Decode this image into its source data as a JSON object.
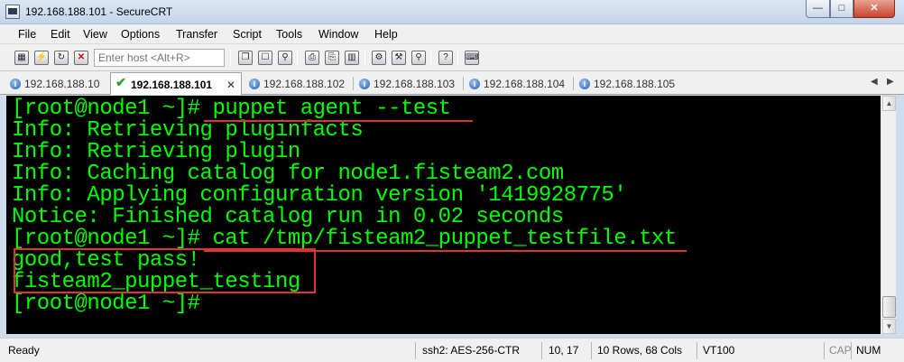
{
  "window": {
    "title": "192.168.188.101 - SecureCRT"
  },
  "menu": [
    "File",
    "Edit",
    "View",
    "Options",
    "Transfer",
    "Script",
    "Tools",
    "Window",
    "Help"
  ],
  "toolbar": {
    "host_placeholder": "Enter host <Alt+R>"
  },
  "tabs": [
    {
      "label": "192.168.188.10",
      "active": false
    },
    {
      "label": "192.168.188.101",
      "active": true
    },
    {
      "label": "192.168.188.102",
      "active": false
    },
    {
      "label": "192.168.188.103",
      "active": false
    },
    {
      "label": "192.168.188.104",
      "active": false
    },
    {
      "label": "192.168.188.105",
      "active": false
    }
  ],
  "terminal": {
    "lines": [
      "[root@node1 ~]# puppet agent --test",
      "Info: Retrieving pluginfacts",
      "Info: Retrieving plugin",
      "Info: Caching catalog for node1.fisteam2.com",
      "Info: Applying configuration version '1419928775'",
      "Notice: Finished catalog run in 0.02 seconds",
      "[root@node1 ~]# cat /tmp/fisteam2_puppet_testfile.txt",
      "good,test pass!",
      "fisteam2_puppet_testing",
      "[root@node1 ~]#"
    ],
    "colors": {
      "text": "#00ff00",
      "background": "#000000",
      "annotation": "#e03434"
    }
  },
  "status": {
    "state": "Ready",
    "cipher": "ssh2: AES-256-CTR",
    "cursor": "10,  17",
    "size": "10 Rows, 68 Cols",
    "emulation": "VT100",
    "caps": "CAP",
    "num": "NUM"
  }
}
